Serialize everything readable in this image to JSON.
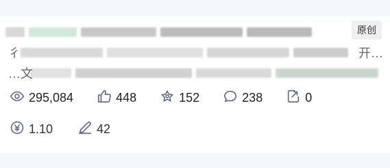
{
  "card": {
    "tag_label": "原创",
    "visible_fragments": {
      "line2_start": "彳",
      "line2_end": "开…",
      "line3_start": "…文"
    }
  },
  "stats": {
    "views": "295,084",
    "likes": "448",
    "stars": "152",
    "comments": "238",
    "shares": "0",
    "reward": "1.10",
    "edits": "42"
  },
  "icons": {
    "views": "eye-icon",
    "likes": "thumbs-up-icon",
    "stars": "star-icon",
    "comments": "comment-icon",
    "shares": "share-icon",
    "reward": "yuan-icon",
    "edits": "pen-icon"
  },
  "colors": {
    "icon": "#5f6b86",
    "text": "#222222",
    "tag_bg": "#f0f0f2"
  }
}
